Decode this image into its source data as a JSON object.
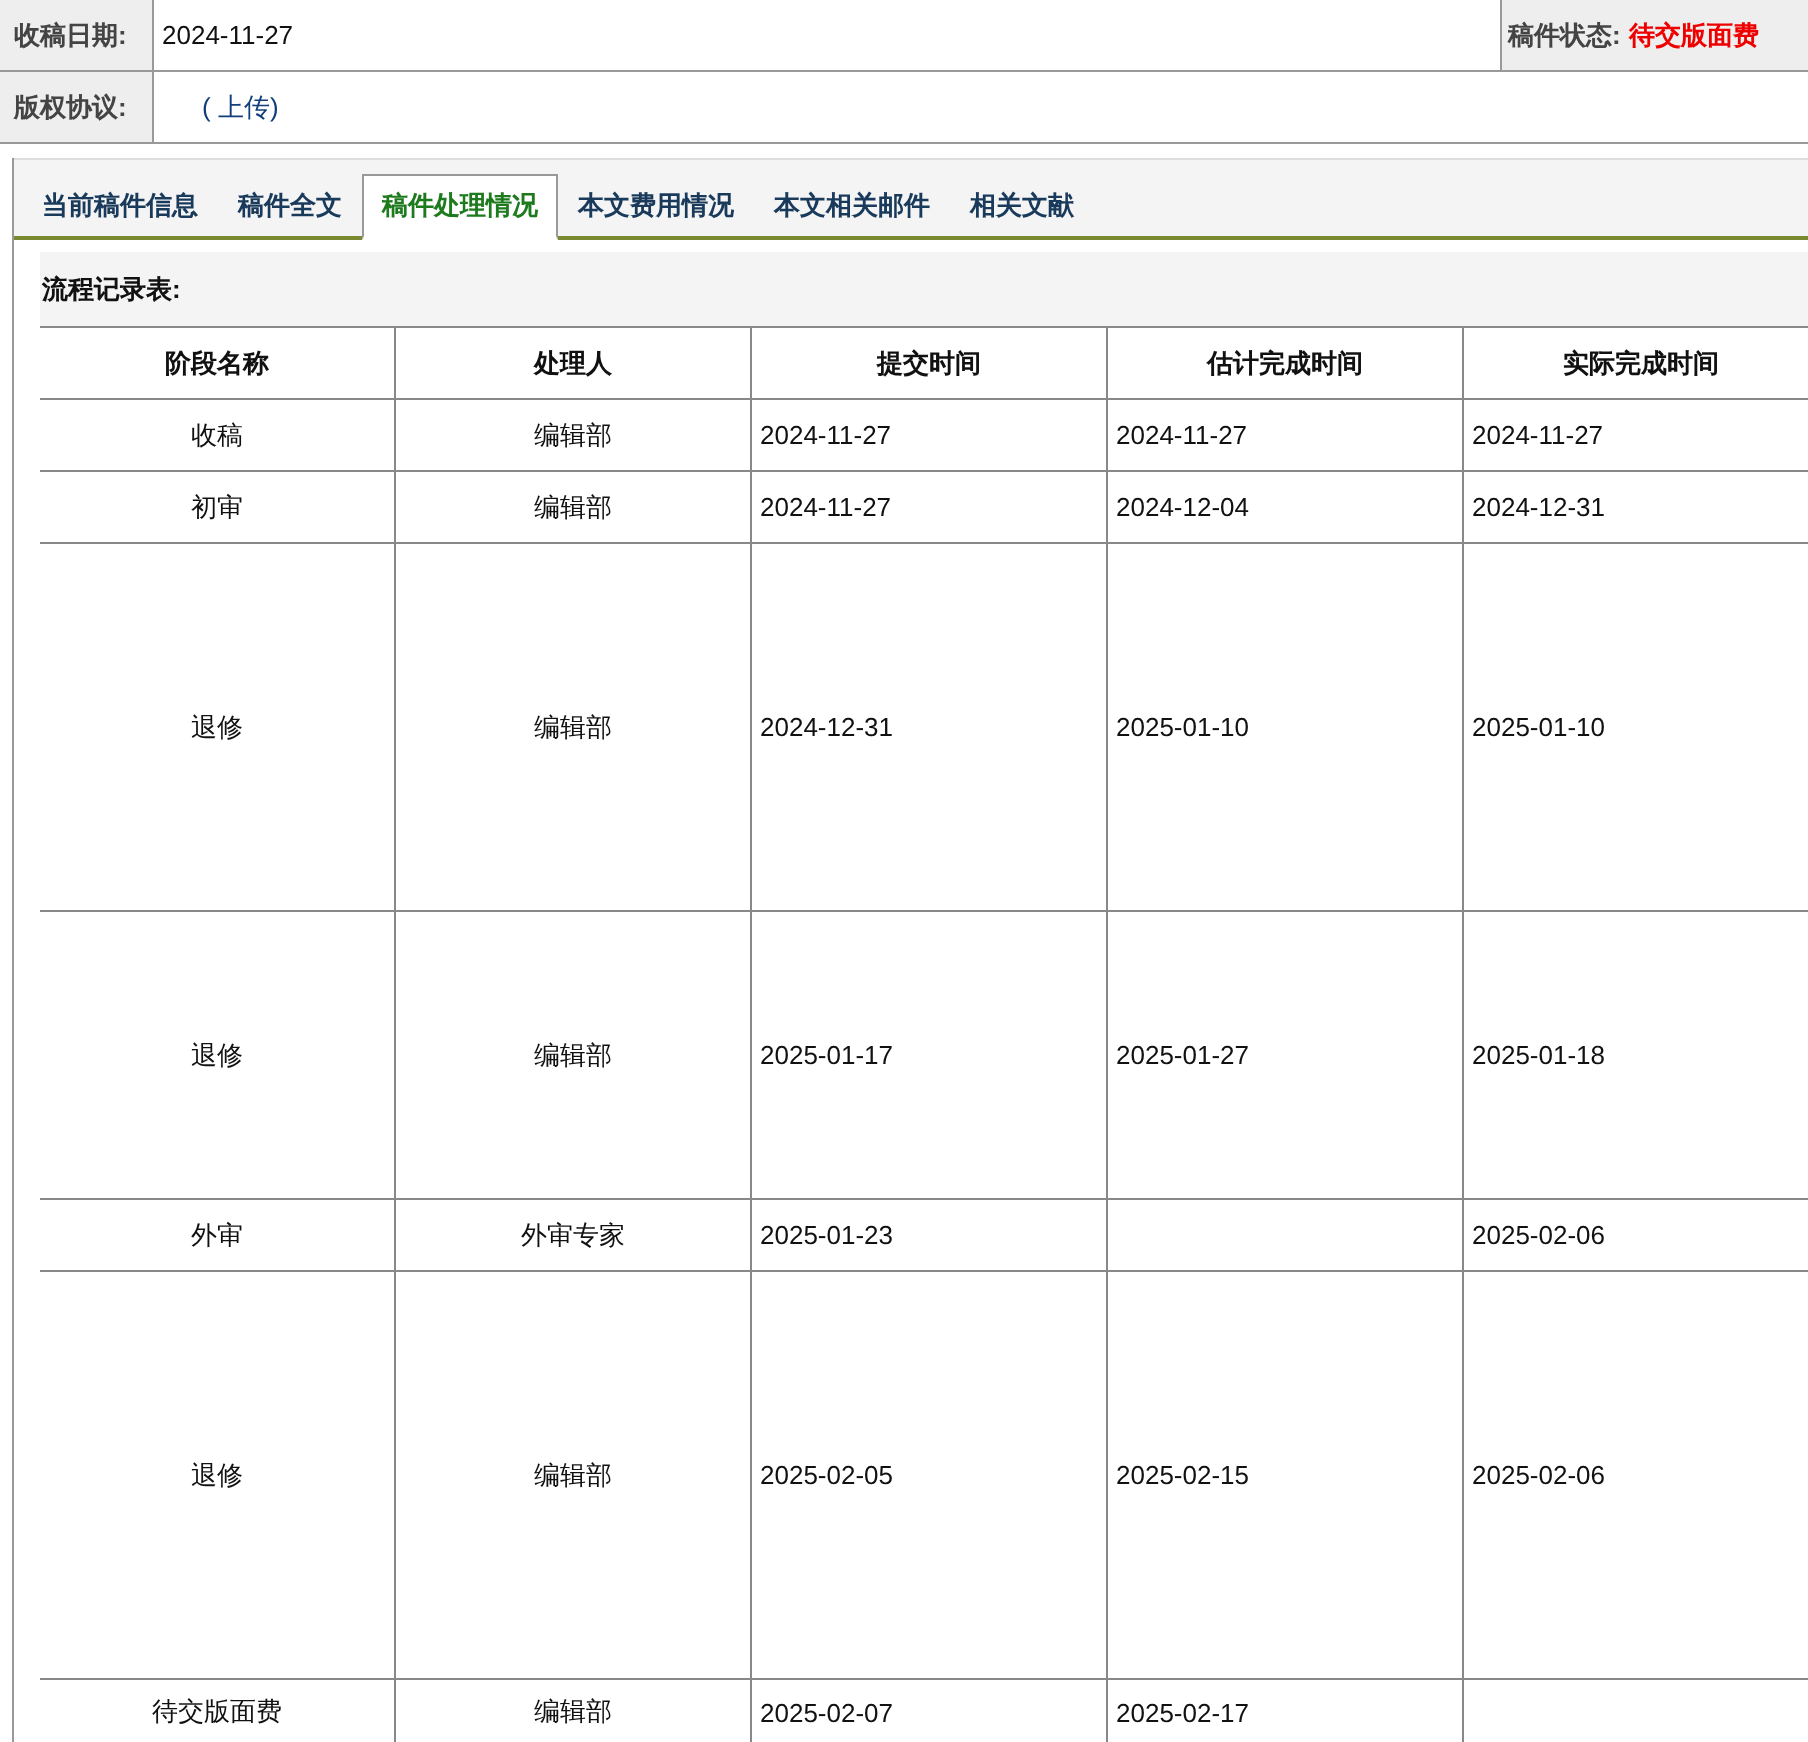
{
  "info": [
    {
      "label": "收稿日期:",
      "value": "2024-11-27",
      "status_label": "稿件状态:",
      "status_value": "待交版面费"
    },
    {
      "label": "版权协议:",
      "link": "( 上传)"
    }
  ],
  "tabs": [
    {
      "label": "当前稿件信息",
      "selected": false
    },
    {
      "label": "稿件全文",
      "selected": false
    },
    {
      "label": "稿件处理情况",
      "selected": true
    },
    {
      "label": "本文费用情况",
      "selected": false
    },
    {
      "label": "本文相关邮件",
      "selected": false
    },
    {
      "label": "相关文献",
      "selected": false
    }
  ],
  "section_title": "流程记录表:",
  "table": {
    "columns": [
      "阶段名称",
      "处理人",
      "提交时间",
      "估计完成时间",
      "实际完成时间"
    ],
    "rows": [
      [
        "收稿",
        "编辑部",
        "2024-11-27",
        "2024-11-27",
        "2024-11-27"
      ],
      [
        "初审",
        "编辑部",
        "2024-11-27",
        "2024-12-04",
        "2024-12-31"
      ],
      [
        "退修",
        "编辑部",
        "2024-12-31",
        "2025-01-10",
        "2025-01-10"
      ],
      [
        "退修",
        "编辑部",
        "2025-01-17",
        "2025-01-27",
        "2025-01-18"
      ],
      [
        "外审",
        "外审专家",
        "2025-01-23",
        "",
        "2025-02-06"
      ],
      [
        "退修",
        "编辑部",
        "2025-02-05",
        "2025-02-15",
        "2025-02-06"
      ],
      [
        "待交版面费",
        "编辑部",
        "2025-02-07",
        "2025-02-17",
        ""
      ]
    ]
  }
}
